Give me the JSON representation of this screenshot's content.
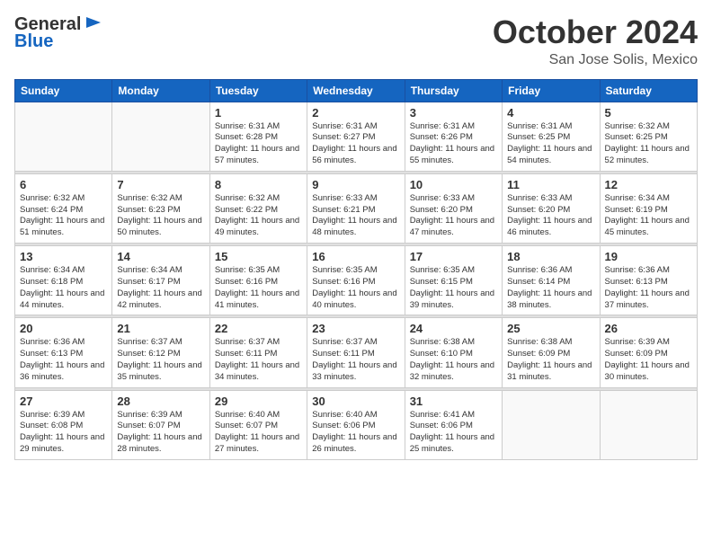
{
  "logo": {
    "line1": "General",
    "line2": "Blue"
  },
  "title": "October 2024",
  "location": "San Jose Solis, Mexico",
  "days_of_week": [
    "Sunday",
    "Monday",
    "Tuesday",
    "Wednesday",
    "Thursday",
    "Friday",
    "Saturday"
  ],
  "weeks": [
    [
      {
        "day": "",
        "sunrise": "",
        "sunset": "",
        "daylight": ""
      },
      {
        "day": "",
        "sunrise": "",
        "sunset": "",
        "daylight": ""
      },
      {
        "day": "1",
        "sunrise": "Sunrise: 6:31 AM",
        "sunset": "Sunset: 6:28 PM",
        "daylight": "Daylight: 11 hours and 57 minutes."
      },
      {
        "day": "2",
        "sunrise": "Sunrise: 6:31 AM",
        "sunset": "Sunset: 6:27 PM",
        "daylight": "Daylight: 11 hours and 56 minutes."
      },
      {
        "day": "3",
        "sunrise": "Sunrise: 6:31 AM",
        "sunset": "Sunset: 6:26 PM",
        "daylight": "Daylight: 11 hours and 55 minutes."
      },
      {
        "day": "4",
        "sunrise": "Sunrise: 6:31 AM",
        "sunset": "Sunset: 6:25 PM",
        "daylight": "Daylight: 11 hours and 54 minutes."
      },
      {
        "day": "5",
        "sunrise": "Sunrise: 6:32 AM",
        "sunset": "Sunset: 6:25 PM",
        "daylight": "Daylight: 11 hours and 52 minutes."
      }
    ],
    [
      {
        "day": "6",
        "sunrise": "Sunrise: 6:32 AM",
        "sunset": "Sunset: 6:24 PM",
        "daylight": "Daylight: 11 hours and 51 minutes."
      },
      {
        "day": "7",
        "sunrise": "Sunrise: 6:32 AM",
        "sunset": "Sunset: 6:23 PM",
        "daylight": "Daylight: 11 hours and 50 minutes."
      },
      {
        "day": "8",
        "sunrise": "Sunrise: 6:32 AM",
        "sunset": "Sunset: 6:22 PM",
        "daylight": "Daylight: 11 hours and 49 minutes."
      },
      {
        "day": "9",
        "sunrise": "Sunrise: 6:33 AM",
        "sunset": "Sunset: 6:21 PM",
        "daylight": "Daylight: 11 hours and 48 minutes."
      },
      {
        "day": "10",
        "sunrise": "Sunrise: 6:33 AM",
        "sunset": "Sunset: 6:20 PM",
        "daylight": "Daylight: 11 hours and 47 minutes."
      },
      {
        "day": "11",
        "sunrise": "Sunrise: 6:33 AM",
        "sunset": "Sunset: 6:20 PM",
        "daylight": "Daylight: 11 hours and 46 minutes."
      },
      {
        "day": "12",
        "sunrise": "Sunrise: 6:34 AM",
        "sunset": "Sunset: 6:19 PM",
        "daylight": "Daylight: 11 hours and 45 minutes."
      }
    ],
    [
      {
        "day": "13",
        "sunrise": "Sunrise: 6:34 AM",
        "sunset": "Sunset: 6:18 PM",
        "daylight": "Daylight: 11 hours and 44 minutes."
      },
      {
        "day": "14",
        "sunrise": "Sunrise: 6:34 AM",
        "sunset": "Sunset: 6:17 PM",
        "daylight": "Daylight: 11 hours and 42 minutes."
      },
      {
        "day": "15",
        "sunrise": "Sunrise: 6:35 AM",
        "sunset": "Sunset: 6:16 PM",
        "daylight": "Daylight: 11 hours and 41 minutes."
      },
      {
        "day": "16",
        "sunrise": "Sunrise: 6:35 AM",
        "sunset": "Sunset: 6:16 PM",
        "daylight": "Daylight: 11 hours and 40 minutes."
      },
      {
        "day": "17",
        "sunrise": "Sunrise: 6:35 AM",
        "sunset": "Sunset: 6:15 PM",
        "daylight": "Daylight: 11 hours and 39 minutes."
      },
      {
        "day": "18",
        "sunrise": "Sunrise: 6:36 AM",
        "sunset": "Sunset: 6:14 PM",
        "daylight": "Daylight: 11 hours and 38 minutes."
      },
      {
        "day": "19",
        "sunrise": "Sunrise: 6:36 AM",
        "sunset": "Sunset: 6:13 PM",
        "daylight": "Daylight: 11 hours and 37 minutes."
      }
    ],
    [
      {
        "day": "20",
        "sunrise": "Sunrise: 6:36 AM",
        "sunset": "Sunset: 6:13 PM",
        "daylight": "Daylight: 11 hours and 36 minutes."
      },
      {
        "day": "21",
        "sunrise": "Sunrise: 6:37 AM",
        "sunset": "Sunset: 6:12 PM",
        "daylight": "Daylight: 11 hours and 35 minutes."
      },
      {
        "day": "22",
        "sunrise": "Sunrise: 6:37 AM",
        "sunset": "Sunset: 6:11 PM",
        "daylight": "Daylight: 11 hours and 34 minutes."
      },
      {
        "day": "23",
        "sunrise": "Sunrise: 6:37 AM",
        "sunset": "Sunset: 6:11 PM",
        "daylight": "Daylight: 11 hours and 33 minutes."
      },
      {
        "day": "24",
        "sunrise": "Sunrise: 6:38 AM",
        "sunset": "Sunset: 6:10 PM",
        "daylight": "Daylight: 11 hours and 32 minutes."
      },
      {
        "day": "25",
        "sunrise": "Sunrise: 6:38 AM",
        "sunset": "Sunset: 6:09 PM",
        "daylight": "Daylight: 11 hours and 31 minutes."
      },
      {
        "day": "26",
        "sunrise": "Sunrise: 6:39 AM",
        "sunset": "Sunset: 6:09 PM",
        "daylight": "Daylight: 11 hours and 30 minutes."
      }
    ],
    [
      {
        "day": "27",
        "sunrise": "Sunrise: 6:39 AM",
        "sunset": "Sunset: 6:08 PM",
        "daylight": "Daylight: 11 hours and 29 minutes."
      },
      {
        "day": "28",
        "sunrise": "Sunrise: 6:39 AM",
        "sunset": "Sunset: 6:07 PM",
        "daylight": "Daylight: 11 hours and 28 minutes."
      },
      {
        "day": "29",
        "sunrise": "Sunrise: 6:40 AM",
        "sunset": "Sunset: 6:07 PM",
        "daylight": "Daylight: 11 hours and 27 minutes."
      },
      {
        "day": "30",
        "sunrise": "Sunrise: 6:40 AM",
        "sunset": "Sunset: 6:06 PM",
        "daylight": "Daylight: 11 hours and 26 minutes."
      },
      {
        "day": "31",
        "sunrise": "Sunrise: 6:41 AM",
        "sunset": "Sunset: 6:06 PM",
        "daylight": "Daylight: 11 hours and 25 minutes."
      },
      {
        "day": "",
        "sunrise": "",
        "sunset": "",
        "daylight": ""
      },
      {
        "day": "",
        "sunrise": "",
        "sunset": "",
        "daylight": ""
      }
    ]
  ]
}
